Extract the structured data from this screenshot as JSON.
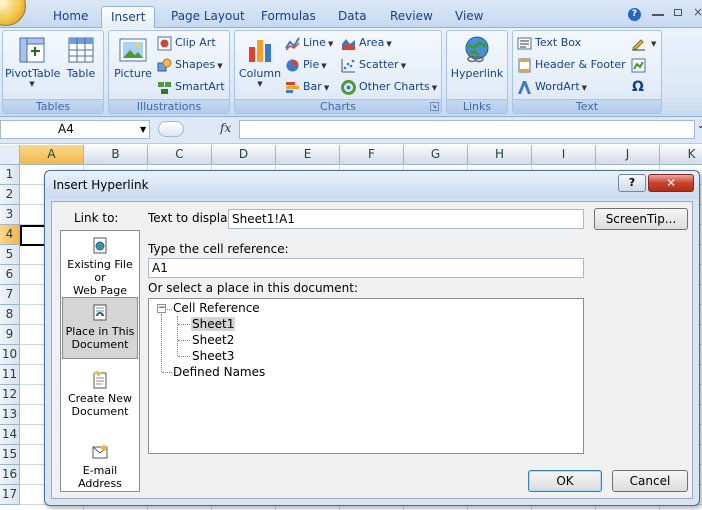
{
  "ribbon": {
    "tabs": [
      "Home",
      "Insert",
      "Page Layout",
      "Formulas",
      "Data",
      "Review",
      "View"
    ],
    "active_tab": "Insert",
    "groups": {
      "tables": {
        "label": "Tables",
        "pivottable": "PivotTable",
        "table": "Table"
      },
      "illustrations": {
        "label": "Illustrations",
        "picture": "Picture",
        "clip_art": "Clip Art",
        "shapes": "Shapes",
        "smartart": "SmartArt"
      },
      "charts": {
        "label": "Charts",
        "column": "Column",
        "line": "Line",
        "pie": "Pie",
        "bar": "Bar",
        "area": "Area",
        "scatter": "Scatter",
        "other_charts": "Other Charts"
      },
      "links": {
        "label": "Links",
        "hyperlink": "Hyperlink"
      },
      "text": {
        "label": "Text",
        "text_box": "Text Box",
        "header_footer": "Header & Footer",
        "wordart": "WordArt",
        "symbol": "Ω"
      }
    }
  },
  "formula_bar": {
    "name_box": "A4",
    "fx": "fx",
    "value": ""
  },
  "sheet": {
    "columns": [
      "A",
      "B",
      "C",
      "D",
      "E",
      "F",
      "G",
      "H",
      "I",
      "J",
      "K"
    ],
    "rows": [
      "1",
      "2",
      "3",
      "4",
      "5",
      "6",
      "7",
      "8",
      "9",
      "10",
      "11",
      "12",
      "13",
      "14",
      "15",
      "16",
      "17"
    ],
    "selected_column": "A",
    "selected_row": "4"
  },
  "dialog": {
    "title": "Insert Hyperlink",
    "help": "?",
    "close": "✕",
    "link_to_label": "Link to:",
    "link_to_items": [
      {
        "line1": "Existing File or",
        "line2": "Web Page"
      },
      {
        "line1": "Place in This",
        "line2": "Document"
      },
      {
        "line1": "Create New",
        "line2": "Document"
      },
      {
        "line1": "E-mail Address",
        "line2": ""
      }
    ],
    "text_to_display_label": "Text to display:",
    "text_to_display_value": "Sheet1!A1",
    "screentip_button": "ScreenTip...",
    "cell_reference_label": "Type the cell reference:",
    "cell_reference_value": "A1",
    "place_label": "Or select a place in this document:",
    "tree": {
      "cell_reference": "Cell Reference",
      "sheets": [
        "Sheet1",
        "Sheet2",
        "Sheet3"
      ],
      "defined_names": "Defined Names",
      "expander": "−"
    },
    "ok_button": "OK",
    "cancel_button": "Cancel"
  }
}
